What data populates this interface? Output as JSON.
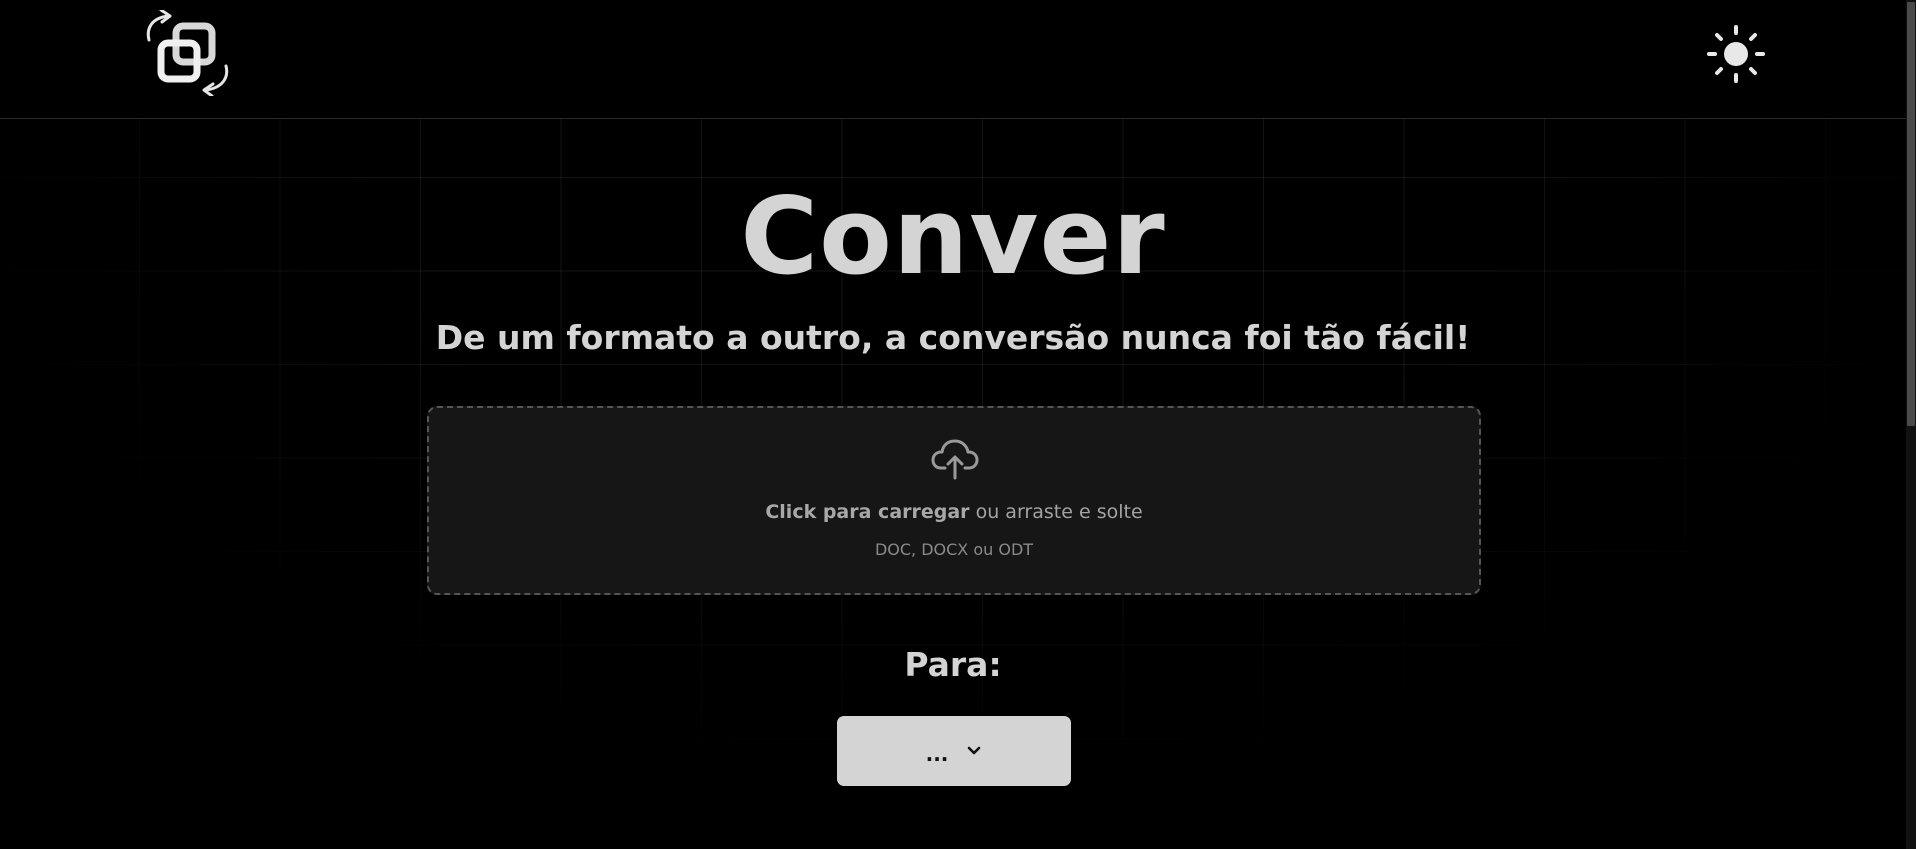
{
  "header": {
    "logo_icon": "convert-logo-icon",
    "theme_toggle_icon": "sun-icon"
  },
  "hero": {
    "title": "Conver",
    "subtitle": "De um formato a outro, a conversão nunca foi tão fácil!"
  },
  "upload": {
    "icon": "cloud-upload-icon",
    "click_text": "Click para carregar",
    "drag_text": " ou arraste e solte",
    "formats": "DOC, DOCX ou ODT"
  },
  "target": {
    "label": "Para:",
    "selected": "...",
    "chevron_icon": "chevron-down-icon"
  },
  "colors": {
    "background": "#000000",
    "text": "#d4d4d4",
    "dropzone_bg": "#161616",
    "button_bg": "#d4d4d4"
  }
}
